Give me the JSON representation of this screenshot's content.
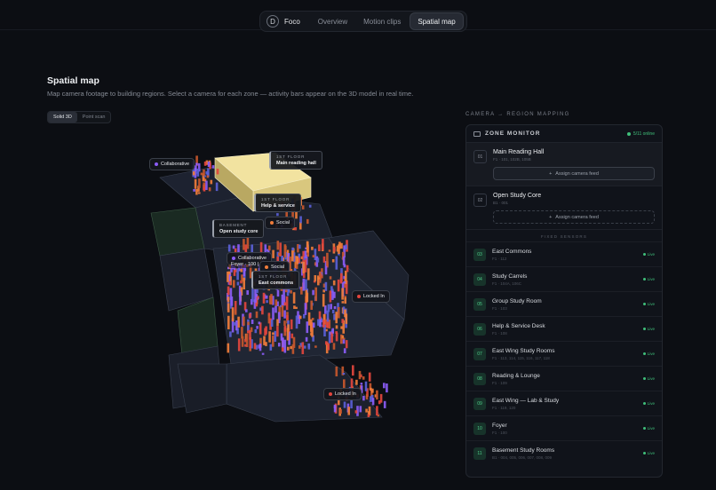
{
  "nav": {
    "brand_initial": "D",
    "brand": "Foco",
    "tabs": [
      "Overview",
      "Motion clips",
      "Spatial map"
    ],
    "active_tab": "Spatial map"
  },
  "page": {
    "title": "Spatial map",
    "subtitle": "Map camera footage to building regions. Select a camera for each zone — activity bars appear on the 3D model in real time."
  },
  "view_toggle": {
    "solid": "Solid 3D",
    "points": "Point scan",
    "selected": "Solid 3D"
  },
  "map": {
    "tags": {
      "collab_top": "Collaborative",
      "social_mid": "Social",
      "collab_mid": "Collaborative",
      "foyer": "Foyer · 100 |",
      "social_low": "Social",
      "locked_right": "Locked In",
      "locked_bottom": "Locked In"
    },
    "zones": {
      "reading": {
        "floor": "1ST FLOOR",
        "name": "Main reading hall"
      },
      "help": {
        "floor": "1ST FLOOR",
        "name": "Help & service"
      },
      "study": {
        "floor": "BASEMENT",
        "name": "Open study core"
      },
      "commons": {
        "floor": "1ST FLOOR",
        "name": "East commons"
      }
    },
    "colors": {
      "collaborative": "#8b5cf6",
      "social": "#f07c3a",
      "locked": "#e2453d",
      "highlight": "#f2e3a0"
    }
  },
  "panel": {
    "label": "CAMERA → REGION MAPPING",
    "title": "ZONE MONITOR",
    "online": "5/11 online",
    "mapping_zones": [
      {
        "num": "01",
        "name": "Main Reading Hall",
        "meta": "F1 · 101, 102B, 105B",
        "assign": "Assign camera feed"
      },
      {
        "num": "02",
        "name": "Open Study Core",
        "meta": "B1 · 001",
        "assign": "Assign camera feed"
      }
    ],
    "fixed_header": "FIXED SENSORS",
    "fixed": [
      {
        "num": "03",
        "name": "East Commons",
        "meta": "F1 · 112",
        "status": "Live"
      },
      {
        "num": "04",
        "name": "Study Carrels",
        "meta": "F1 · 104A, 106C",
        "status": "Live"
      },
      {
        "num": "05",
        "name": "Group Study Room",
        "meta": "F1 · 103",
        "status": "Live"
      },
      {
        "num": "06",
        "name": "Help & Service Desk",
        "meta": "F1 · 108",
        "status": "Live"
      },
      {
        "num": "07",
        "name": "East Wing Study Rooms",
        "meta": "F1 · 113, 114, 115, 116, 117, 118",
        "status": "Live"
      },
      {
        "num": "08",
        "name": "Reading & Lounge",
        "meta": "F1 · 109",
        "status": "Live"
      },
      {
        "num": "09",
        "name": "East Wing — Lab & Study",
        "meta": "F1 · 119, 120",
        "status": "Live"
      },
      {
        "num": "10",
        "name": "Foyer",
        "meta": "F1 · 100",
        "status": "Live"
      },
      {
        "num": "11",
        "name": "Basement Study Rooms",
        "meta": "B1 · 004, 005, 006, 007, 008, 009",
        "status": "Live"
      }
    ]
  }
}
